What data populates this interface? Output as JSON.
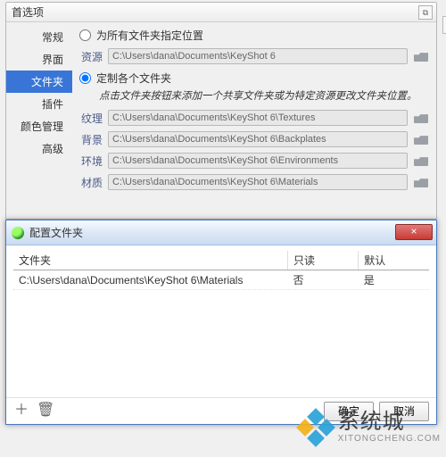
{
  "pref": {
    "title": "首选项",
    "close_glyph": "⧉",
    "sidebar": {
      "items": [
        {
          "label": "常规"
        },
        {
          "label": "界面"
        },
        {
          "label": "文件夹"
        },
        {
          "label": "插件"
        },
        {
          "label": "颜色管理"
        },
        {
          "label": "高级"
        }
      ],
      "selected_index": 2
    },
    "content": {
      "radio_all_label": "为所有文件夹指定位置",
      "radio_each_label": "定制各个文件夹",
      "selected_radio": "each",
      "source_label": "资源",
      "source_path": "C:\\Users\\dana\\Documents\\KeyShot 6",
      "hint": "点击文件夹按钮来添加一个共享文件夹或为特定资源更改文件夹位置。",
      "rows": [
        {
          "label": "纹理",
          "path": "C:\\Users\\dana\\Documents\\KeyShot 6\\Textures"
        },
        {
          "label": "背景",
          "path": "C:\\Users\\dana\\Documents\\KeyShot 6\\Backplates"
        },
        {
          "label": "环境",
          "path": "C:\\Users\\dana\\Documents\\KeyShot 6\\Environments"
        },
        {
          "label": "材质",
          "path": "C:\\Users\\dana\\Documents\\KeyShot 6\\Materials"
        }
      ]
    }
  },
  "dialog": {
    "title": "配置文件夹",
    "close_glyph": "×",
    "columns": {
      "folder": "文件夹",
      "readonly": "只读",
      "default": "默认"
    },
    "rows": [
      {
        "folder": "C:\\Users\\dana\\Documents\\KeyShot 6\\Materials",
        "readonly": "否",
        "default": "是"
      }
    ],
    "footer": {
      "add_glyph": "＋",
      "delete_glyph": "🗑",
      "ok_label": "确定",
      "cancel_label": "取消"
    }
  },
  "watermark": {
    "cn": "系统城",
    "en": "XITONGCHENG.COM"
  }
}
